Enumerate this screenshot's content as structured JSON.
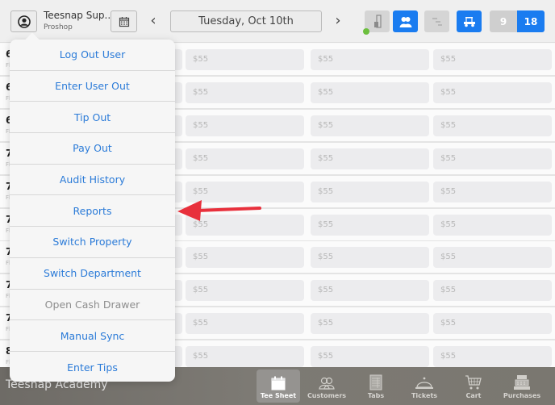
{
  "header": {
    "user_name": "Teesnap Sup...",
    "department": "Proshop",
    "date": "Tuesday, Oct 10th",
    "prev_label": "‹",
    "next_label": "›",
    "holes": {
      "nine": "9",
      "eighteen": "18",
      "selected": "18"
    },
    "status_color": "#6cbf3e",
    "accent_color": "#1a7cf0"
  },
  "tee_sheet": {
    "rows": [
      {
        "time": "6",
        "sub": "Fl",
        "prices": [
          "$55",
          "$55",
          "$55"
        ]
      },
      {
        "time": "6",
        "sub": "Fl",
        "prices": [
          "$55",
          "$55",
          "$55"
        ]
      },
      {
        "time": "6",
        "sub": "Fl",
        "prices": [
          "$55",
          "$55",
          "$55"
        ]
      },
      {
        "time": "7",
        "sub": "Fl",
        "prices": [
          "$55",
          "$55",
          "$55"
        ]
      },
      {
        "time": "7",
        "sub": "Fl",
        "prices": [
          "$55",
          "$55",
          "$55"
        ]
      },
      {
        "time": "7",
        "sub": "Fl",
        "prices": [
          "$55",
          "$55",
          "$55"
        ]
      },
      {
        "time": "7",
        "sub": "Fl",
        "prices": [
          "$55",
          "$55",
          "$55"
        ]
      },
      {
        "time": "7",
        "sub": "Fl",
        "prices": [
          "$55",
          "$55",
          "$55"
        ]
      },
      {
        "time": "7",
        "sub": "Fl",
        "prices": [
          "$55",
          "$55",
          "$55"
        ]
      },
      {
        "time": "8",
        "sub": "Fl",
        "prices": [
          "$55",
          "$55",
          "$55"
        ]
      }
    ]
  },
  "menu": {
    "items": [
      {
        "label": "Log Out User",
        "enabled": true
      },
      {
        "label": "Enter User Out",
        "enabled": true
      },
      {
        "label": "Tip Out",
        "enabled": true
      },
      {
        "label": "Pay Out",
        "enabled": true
      },
      {
        "label": "Audit History",
        "enabled": true
      },
      {
        "label": "Reports",
        "enabled": true
      },
      {
        "label": "Switch Property",
        "enabled": true
      },
      {
        "label": "Switch Department",
        "enabled": true
      },
      {
        "label": "Open Cash Drawer",
        "enabled": false
      },
      {
        "label": "Manual Sync",
        "enabled": true
      },
      {
        "label": "Enter Tips",
        "enabled": true
      }
    ],
    "highlighted": "Reports",
    "annotation_color": "#e8303c"
  },
  "footer": {
    "brand": "Teesnap Academy",
    "tabs": [
      {
        "label": "Tee Sheet",
        "icon": "calendar-icon",
        "active": true
      },
      {
        "label": "Customers",
        "icon": "customers-icon",
        "active": false
      },
      {
        "label": "Tabs",
        "icon": "tabs-icon",
        "active": false
      },
      {
        "label": "Tickets",
        "icon": "cloche-icon",
        "active": false
      },
      {
        "label": "Cart",
        "icon": "cart-icon",
        "active": false
      },
      {
        "label": "Purchases",
        "icon": "register-icon",
        "active": false
      }
    ]
  }
}
